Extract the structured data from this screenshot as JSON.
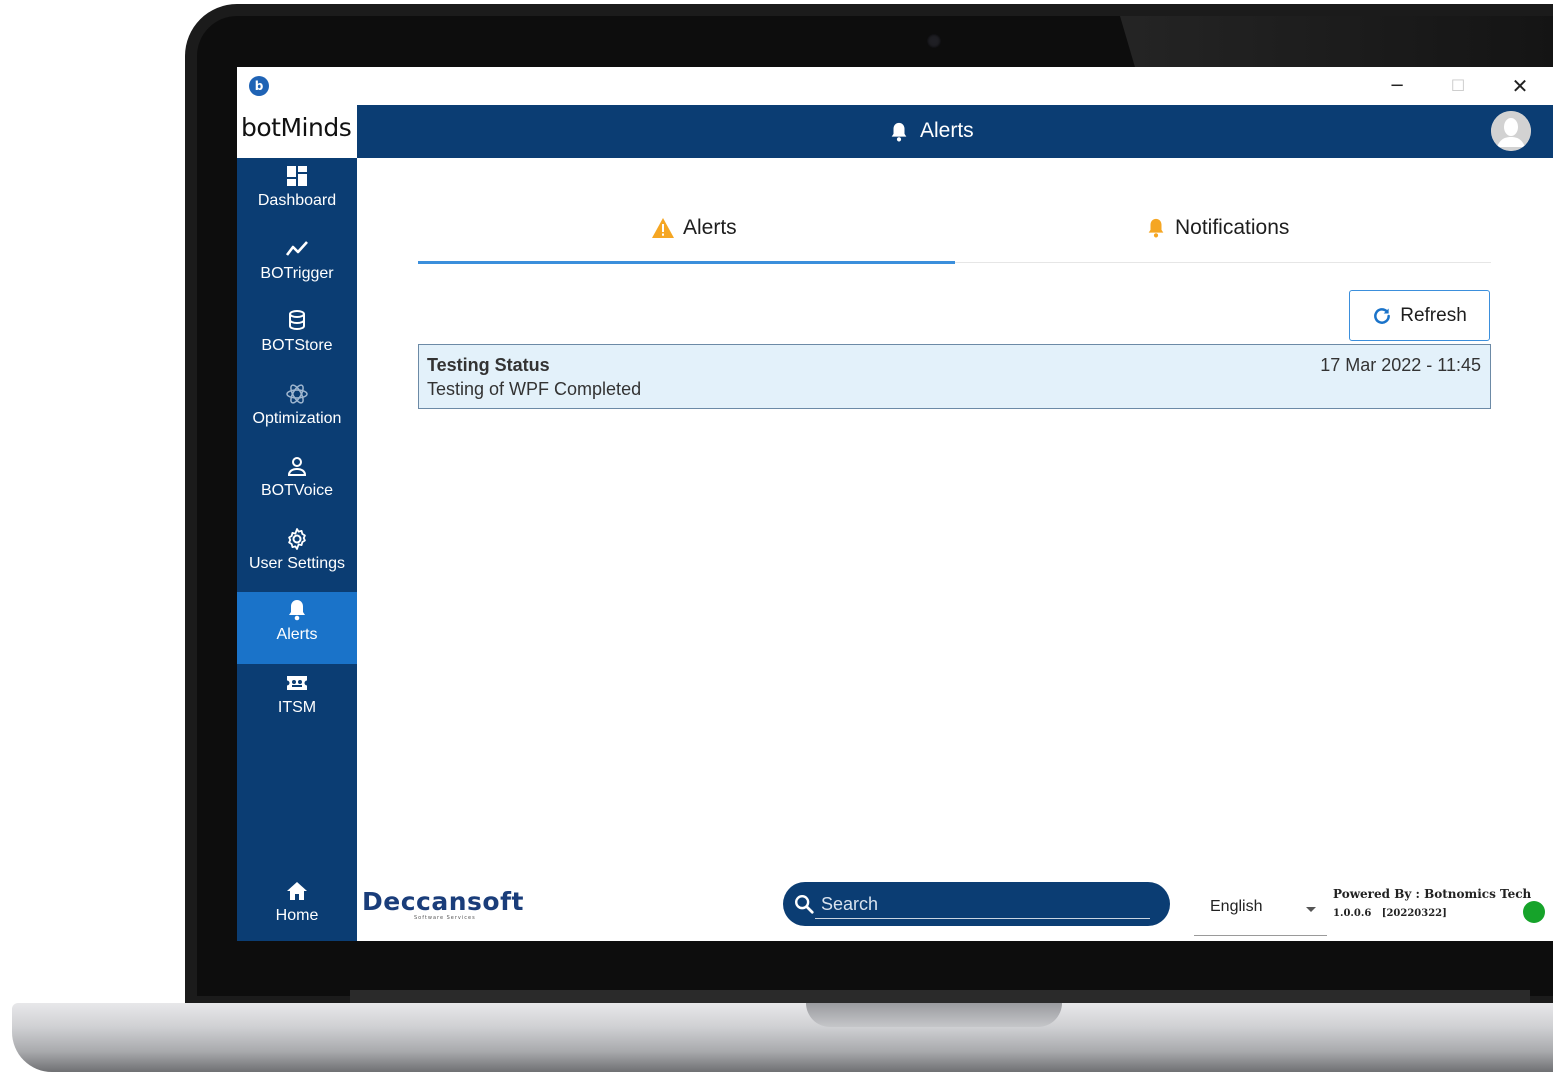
{
  "app": {
    "logo_text": "botMinds",
    "header_title": "Alerts"
  },
  "window": {
    "min_glyph": "−",
    "max_glyph": "☐",
    "close_glyph": "✕"
  },
  "sidebar": {
    "items": [
      {
        "label": "Dashboard",
        "icon": "dashboard-icon"
      },
      {
        "label": "BOTrigger",
        "icon": "trend-icon"
      },
      {
        "label": "BOTStore",
        "icon": "database-icon"
      },
      {
        "label": "Optimization",
        "icon": "atom-icon"
      },
      {
        "label": "BOTVoice",
        "icon": "user-icon"
      },
      {
        "label": "User Settings",
        "icon": "gear-icon"
      },
      {
        "label": "Alerts",
        "icon": "bell-icon",
        "active": true
      },
      {
        "label": "ITSM",
        "icon": "ticket-icon"
      }
    ],
    "home_label": "Home"
  },
  "tabs": {
    "alerts_label": "Alerts",
    "notifications_label": "Notifications"
  },
  "toolbar": {
    "refresh_label": "Refresh"
  },
  "alerts": [
    {
      "title": "Testing Status",
      "message": "Testing of WPF Completed",
      "time": "17 Mar 2022 - 11:45"
    }
  ],
  "footer": {
    "brand": "Deccansoft",
    "brand_sub": "Software Services",
    "search_placeholder": "Search",
    "language": "English",
    "powered_by": "Powered By : Botnomics Tech",
    "version": "1.0.0.6   [20220322]"
  },
  "colors": {
    "navy": "#0b3d73",
    "active": "#1a73c9",
    "accent": "#3b8fdc",
    "alert_bg": "#e3f1fa",
    "warning": "#f5a623",
    "status_ok": "#16a32a"
  }
}
